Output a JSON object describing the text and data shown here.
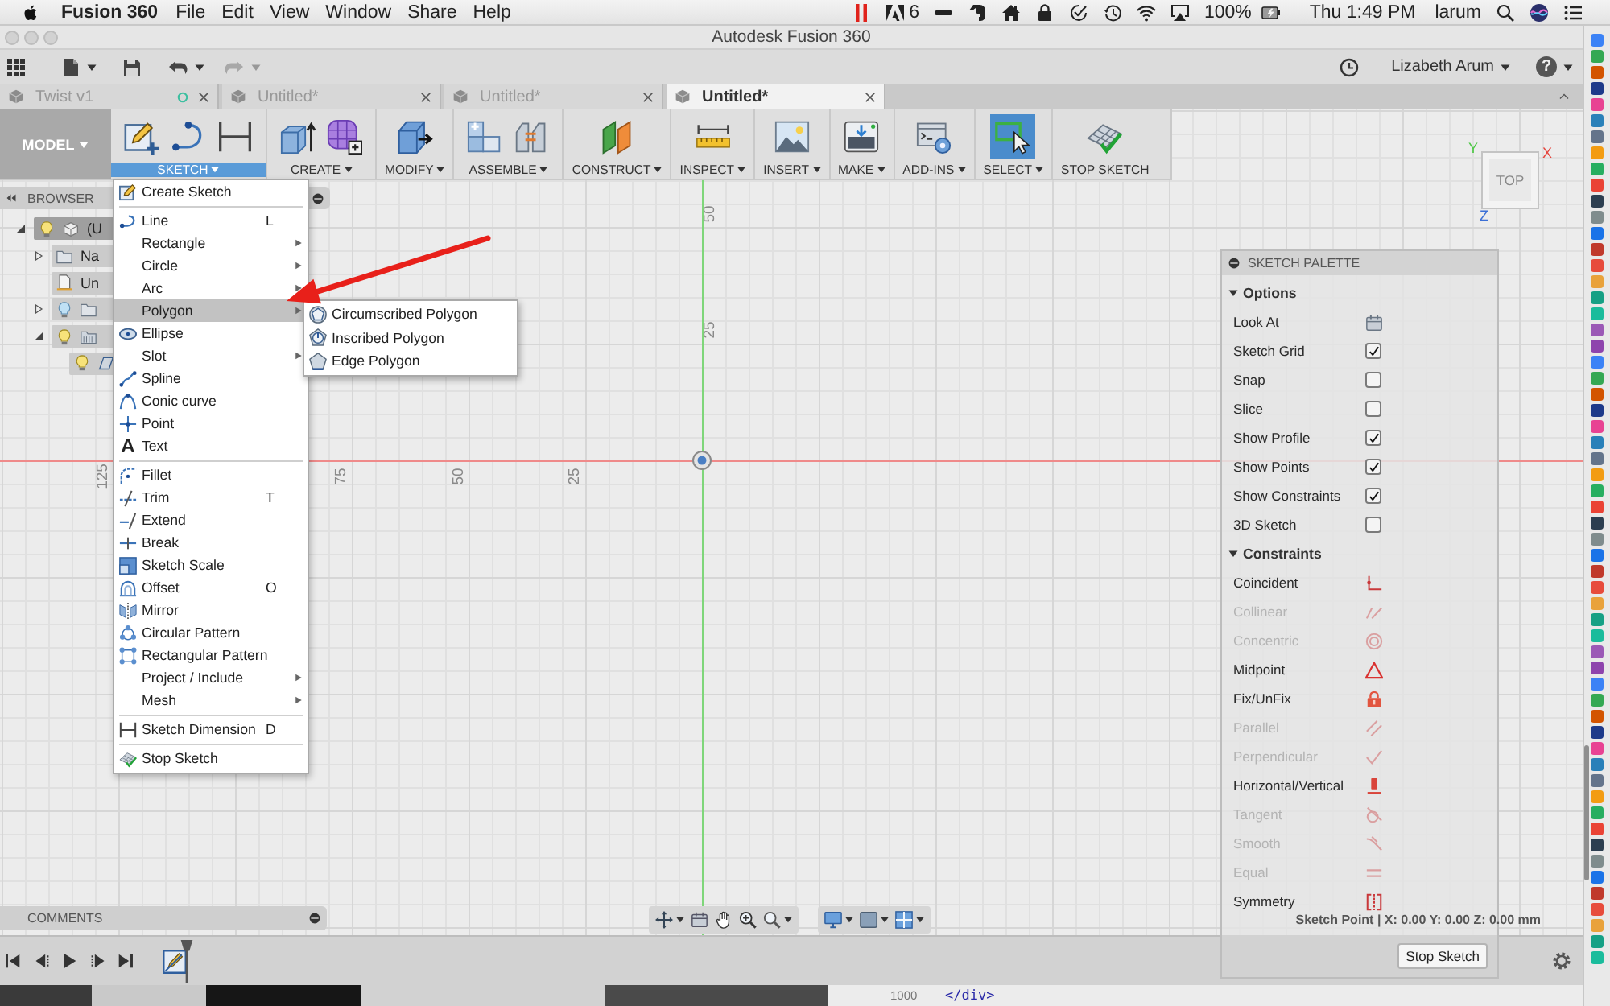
{
  "menubar": {
    "app": "Fusion 360",
    "menus": [
      "File",
      "Edit",
      "View",
      "Window",
      "Share",
      "Help"
    ],
    "status": {
      "adobe_count": "6",
      "battery": "100%",
      "clock": "Thu 1:49 PM",
      "user": "larum"
    }
  },
  "window": {
    "title": "Autodesk Fusion 360"
  },
  "toolbar": {
    "user": "Lizabeth Arum",
    "help": "?"
  },
  "tabs": [
    {
      "label": "Twist v1",
      "selected": false,
      "status_ring": true
    },
    {
      "label": "Untitled*",
      "selected": false,
      "status_ring": false
    },
    {
      "label": "Untitled*",
      "selected": false,
      "status_ring": false
    },
    {
      "label": "Untitled*",
      "selected": true,
      "status_ring": false
    }
  ],
  "workspace": {
    "label": "MODEL"
  },
  "ribbon": [
    {
      "kind": "sketch",
      "label": "SKETCH",
      "open": true,
      "active": false,
      "dropdown": true
    },
    {
      "kind": "create",
      "label": "CREATE",
      "open": false,
      "active": false,
      "dropdown": true
    },
    {
      "kind": "modify",
      "label": "MODIFY",
      "open": false,
      "active": false,
      "dropdown": true
    },
    {
      "kind": "assemble",
      "label": "ASSEMBLE",
      "open": false,
      "active": false,
      "dropdown": true
    },
    {
      "kind": "construct",
      "label": "CONSTRUCT",
      "open": false,
      "active": false,
      "dropdown": true
    },
    {
      "kind": "inspect",
      "label": "INSPECT",
      "open": false,
      "active": false,
      "dropdown": true
    },
    {
      "kind": "insert",
      "label": "INSERT",
      "open": false,
      "active": false,
      "dropdown": true
    },
    {
      "kind": "make",
      "label": "MAKE",
      "open": false,
      "active": false,
      "dropdown": true
    },
    {
      "kind": "addins",
      "label": "ADD-INS",
      "open": false,
      "active": false,
      "dropdown": true
    },
    {
      "kind": "select",
      "label": "SELECT",
      "open": false,
      "active": true,
      "dropdown": true
    },
    {
      "kind": "finish",
      "label": "STOP SKETCH",
      "open": false,
      "active": false,
      "dropdown": false
    }
  ],
  "browser": {
    "title": "BROWSER",
    "tree": [
      {
        "kind": "component",
        "label": "(U",
        "selected": true,
        "expanded": true,
        "lit": true,
        "children": [
          {
            "kind": "folder",
            "label": "Na",
            "selected": false,
            "expanded": false
          },
          {
            "kind": "units",
            "label": "Un",
            "selected": false
          },
          {
            "kind": "folder",
            "selected": false,
            "expanded": false,
            "lit": false
          },
          {
            "kind": "sketches",
            "selected": false,
            "expanded": true,
            "lit": true,
            "children": [
              {
                "kind": "sketch",
                "selected": false,
                "lit": true
              }
            ]
          }
        ]
      }
    ]
  },
  "sketch_menu": {
    "sections": [
      {
        "items": [
          {
            "kind": "create",
            "label": "Create Sketch",
            "selected": false,
            "submenu": false
          }
        ]
      },
      {
        "items": [
          {
            "kind": "line",
            "label": "Line",
            "shortcut": "L",
            "selected": false,
            "submenu": false
          },
          {
            "kind": "plain",
            "label": "Rectangle",
            "selected": false,
            "submenu": true
          },
          {
            "kind": "plain",
            "label": "Circle",
            "selected": false,
            "submenu": true
          },
          {
            "kind": "plain",
            "label": "Arc",
            "selected": false,
            "submenu": true
          },
          {
            "kind": "plain",
            "label": "Polygon",
            "selected": true,
            "submenu": true,
            "flyout": [
              {
                "kind": "circumscribed",
                "label": "Circumscribed Polygon"
              },
              {
                "kind": "inscribed",
                "label": "Inscribed Polygon"
              },
              {
                "kind": "edge",
                "label": "Edge Polygon"
              }
            ]
          },
          {
            "kind": "ellipse",
            "label": "Ellipse",
            "selected": false,
            "submenu": false
          },
          {
            "kind": "plain",
            "label": "Slot",
            "selected": false,
            "submenu": true
          },
          {
            "kind": "spline",
            "label": "Spline",
            "selected": false,
            "submenu": false
          },
          {
            "kind": "conic",
            "label": "Conic curve",
            "selected": false,
            "submenu": false
          },
          {
            "kind": "point",
            "label": "Point",
            "selected": false,
            "submenu": false
          },
          {
            "kind": "glyph",
            "glyph": "A",
            "label": "Text",
            "selected": false,
            "submenu": false
          }
        ]
      },
      {
        "items": [
          {
            "kind": "fillet",
            "label": "Fillet",
            "selected": false,
            "submenu": false
          },
          {
            "kind": "trim",
            "label": "Trim",
            "shortcut": "T",
            "selected": false,
            "submenu": false
          },
          {
            "kind": "extend",
            "label": "Extend",
            "selected": false,
            "submenu": false
          },
          {
            "kind": "break",
            "label": "Break",
            "selected": false,
            "submenu": false
          },
          {
            "kind": "scale",
            "label": "Sketch Scale",
            "selected": false,
            "submenu": false
          },
          {
            "kind": "offset",
            "label": "Offset",
            "shortcut": "O",
            "selected": false,
            "submenu": false
          },
          {
            "kind": "mirror",
            "label": "Mirror",
            "selected": false,
            "submenu": false
          },
          {
            "kind": "circular",
            "label": "Circular Pattern",
            "selected": false,
            "submenu": false
          },
          {
            "kind": "rectangular",
            "label": "Rectangular Pattern",
            "selected": false,
            "submenu": false
          },
          {
            "kind": "plain",
            "label": "Project / Include",
            "selected": false,
            "submenu": true
          },
          {
            "kind": "plain",
            "label": "Mesh",
            "selected": false,
            "submenu": true
          }
        ]
      },
      {
        "items": [
          {
            "kind": "dimension",
            "label": "Sketch Dimension",
            "shortcut": "D",
            "selected": false,
            "submenu": false
          }
        ]
      },
      {
        "items": [
          {
            "kind": "stop",
            "label": "Stop Sketch",
            "selected": false,
            "submenu": false
          }
        ]
      }
    ]
  },
  "canvas": {
    "axis_labels": {
      "vertical": [
        "50",
        "25"
      ],
      "horizontal": [
        "125",
        "75",
        "50",
        "25"
      ]
    },
    "status": "Sketch Point | X: 0.00 Y: 0.00 Z: 0.00 mm"
  },
  "view_cube": {
    "face": "TOP",
    "axes": [
      {
        "label": "Y",
        "color": "#4cc744"
      },
      {
        "label": "X",
        "color": "#e5443c"
      },
      {
        "label": "Z",
        "color": "#3b6fd6"
      }
    ]
  },
  "sketch_palette": {
    "title": "SKETCH PALETTE",
    "sections": [
      {
        "label": "Options",
        "expanded": true,
        "rows": [
          {
            "kind": "button",
            "label": "Look At"
          },
          {
            "kind": "checkbox",
            "label": "Sketch Grid",
            "checked": true
          },
          {
            "kind": "checkbox",
            "label": "Snap",
            "checked": false
          },
          {
            "kind": "checkbox",
            "label": "Slice",
            "checked": false
          },
          {
            "kind": "checkbox",
            "label": "Show Profile",
            "checked": true
          },
          {
            "kind": "checkbox",
            "label": "Show Points",
            "checked": true
          },
          {
            "kind": "checkbox",
            "label": "Show Constraints",
            "checked": true
          },
          {
            "kind": "checkbox",
            "label": "3D Sketch",
            "checked": false
          }
        ]
      },
      {
        "label": "Constraints",
        "expanded": true,
        "rows": [
          {
            "kind": "coincident",
            "label": "Coincident",
            "disabled": false
          },
          {
            "kind": "collinear",
            "label": "Collinear",
            "disabled": true
          },
          {
            "kind": "concentric",
            "label": "Concentric",
            "disabled": true
          },
          {
            "kind": "midpoint",
            "label": "Midpoint",
            "disabled": false
          },
          {
            "kind": "fix",
            "label": "Fix/UnFix",
            "disabled": false
          },
          {
            "kind": "parallel",
            "label": "Parallel",
            "disabled": true
          },
          {
            "kind": "perpendicular",
            "label": "Perpendicular",
            "disabled": true
          },
          {
            "kind": "horizontal",
            "label": "Horizontal/Vertical",
            "disabled": false
          },
          {
            "kind": "tangent",
            "label": "Tangent",
            "disabled": true
          },
          {
            "kind": "smooth",
            "label": "Smooth",
            "disabled": true
          },
          {
            "kind": "equal",
            "label": "Equal",
            "disabled": true
          },
          {
            "kind": "symmetry",
            "label": "Symmetry",
            "disabled": false
          }
        ]
      }
    ],
    "button": "Stop Sketch"
  },
  "comments": {
    "title": "COMMENTS"
  },
  "background_window": {
    "line_number": "1000",
    "code": "</div>"
  }
}
